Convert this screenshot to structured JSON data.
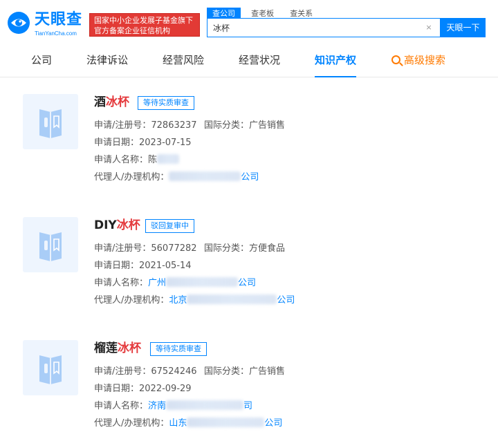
{
  "header": {
    "logo_text": "天眼查",
    "logo_sub": "TianYanCha.com",
    "banner_line1": "国家中小企业发展子基金旗下",
    "banner_line2": "官方备案企业征信机构",
    "search_tabs": [
      "查公司",
      "查老板",
      "查关系"
    ],
    "search_value": "冰杯",
    "clear_glyph": "×",
    "search_button": "天眼一下"
  },
  "nav": {
    "items": [
      "公司",
      "法律诉讼",
      "经营风险",
      "经营状况",
      "知识产权"
    ],
    "active": "知识产权",
    "advanced": "高级搜索"
  },
  "records": [
    {
      "title_prefix": "酒",
      "title_highlight": "冰杯",
      "status": "等待实质审查",
      "reg_label": "申请/注册号：",
      "reg_no": "72863237",
      "class_label": "国际分类：",
      "class": "广告销售",
      "date_label": "申请日期：",
      "date": "2023-07-15",
      "applicant_label": "申请人名称：",
      "applicant_visible": "陈",
      "agent_label": "代理人/办理机构：",
      "agent_visible_start": "",
      "agent_visible_end": "公司"
    },
    {
      "title_prefix": "DIY",
      "title_highlight": "冰杯",
      "status": "驳回复审中",
      "reg_label": "申请/注册号：",
      "reg_no": "56077282",
      "class_label": "国际分类：",
      "class": "方便食品",
      "date_label": "申请日期：",
      "date": "2021-05-14",
      "applicant_label": "申请人名称：",
      "applicant_visible_start": "广州",
      "applicant_visible_end": "公司",
      "agent_label": "代理人/办理机构：",
      "agent_visible_start": "北京",
      "agent_visible_end": "公司"
    },
    {
      "title_prefix": "榴莲",
      "title_highlight": "冰杯",
      "status": "等待实质审查",
      "reg_label": "申请/注册号：",
      "reg_no": "67524246",
      "class_label": "国际分类：",
      "class": "广告销售",
      "date_label": "申请日期：",
      "date": "2022-09-29",
      "applicant_label": "申请人名称：",
      "applicant_visible_start": "济南",
      "applicant_visible_end": "司",
      "agent_label": "代理人/办理机构：",
      "agent_visible_start": "山东",
      "agent_visible_end": "公司"
    }
  ],
  "colors": {
    "brand_blue": "#0084ff",
    "highlight_red": "#e4393c",
    "banner_red": "#e23a35",
    "advanced_orange": "#ff7a00"
  }
}
